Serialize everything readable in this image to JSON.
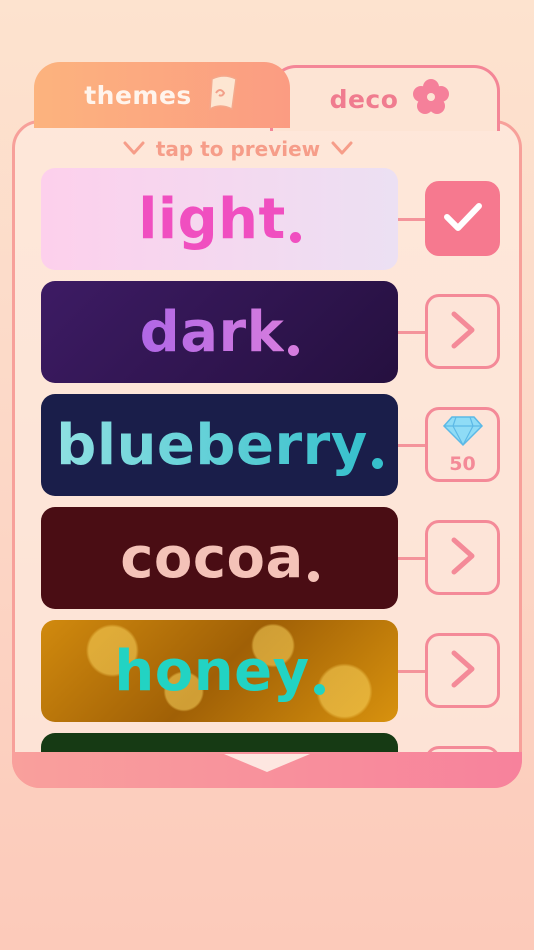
{
  "tabs": {
    "themes_label": "themes",
    "deco_label": "deco",
    "themes_icon": "scroll-icon",
    "deco_icon": "flower-icon"
  },
  "hint": {
    "label": "tap to preview"
  },
  "themes": [
    {
      "name": "light",
      "action": "selected",
      "action_icon": "checkmark-icon"
    },
    {
      "name": "dark",
      "action": "preview",
      "action_icon": "chevron-right-icon"
    },
    {
      "name": "blueberry",
      "action": "buy",
      "action_icon": "diamond-icon",
      "price": "50"
    },
    {
      "name": "cocoa",
      "action": "preview",
      "action_icon": "chevron-right-icon"
    },
    {
      "name": "honey",
      "action": "preview",
      "action_icon": "chevron-right-icon"
    }
  ],
  "colors": {
    "accent": "#f6798f",
    "tab_active": "#fcb37e",
    "panel_border": "#f7a09a"
  }
}
